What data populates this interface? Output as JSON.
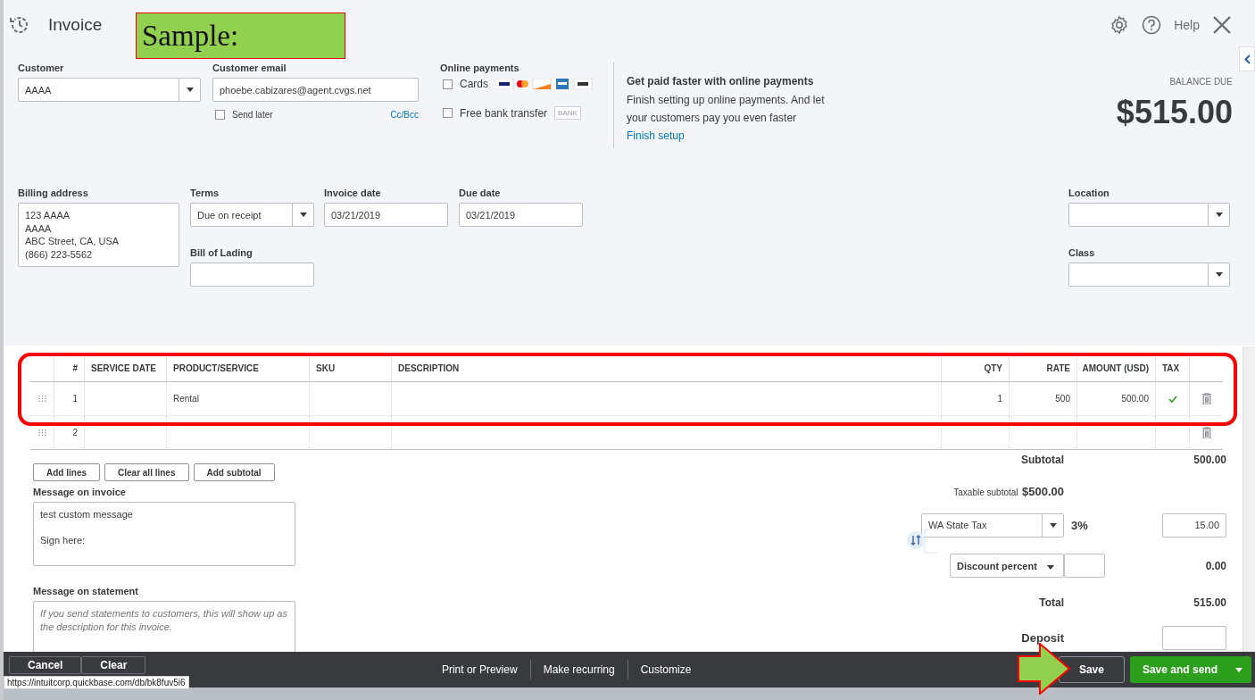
{
  "header": {
    "title": "Invoice",
    "help": "Help"
  },
  "annotation": {
    "label": "Sample:"
  },
  "customer": {
    "label": "Customer",
    "value": "AAAA"
  },
  "email": {
    "label": "Customer email",
    "value": "phoebe.cabizares@agent.cvgs.net",
    "send_later_label": "Send later",
    "send_later_checked": false,
    "cc_link": "Cc/Bcc"
  },
  "online_payments": {
    "label": "Online payments",
    "options": [
      {
        "kind": "cards",
        "label": "Cards",
        "checked": false
      },
      {
        "kind": "bank",
        "label": "Free bank transfer",
        "checked": false,
        "badge": "BANK"
      }
    ]
  },
  "promo": {
    "title": "Get paid faster with online payments",
    "body": "Finish setting up online payments. And let your customers pay you even faster",
    "link": "Finish setup"
  },
  "balance": {
    "label": "BALANCE DUE",
    "amount": "$515.00"
  },
  "billing_address": {
    "label": "Billing address",
    "value": "123 AAAA\nAAAA\nABC Street, CA, USA\n(866) 223-5562"
  },
  "terms": {
    "label": "Terms",
    "value": "Due on receipt"
  },
  "invoice_date": {
    "label": "Invoice date",
    "value": "03/21/2019"
  },
  "due_date": {
    "label": "Due date",
    "value": "03/21/2019"
  },
  "bill_of_lading": {
    "label": "Bill of Lading"
  },
  "location": {
    "label": "Location"
  },
  "class": {
    "label": "Class"
  },
  "table": {
    "columns": [
      "#",
      "SERVICE DATE",
      "PRODUCT/SERVICE",
      "SKU",
      "DESCRIPTION",
      "QTY",
      "RATE",
      "AMOUNT (USD)",
      "TAX"
    ],
    "rows": [
      {
        "number": "1",
        "product": "Rental",
        "qty": "1",
        "rate": "500",
        "amount": "500.00",
        "taxable": true
      },
      {
        "number": "2",
        "taxable": false
      }
    ]
  },
  "table_buttons": [
    "Add lines",
    "Clear all lines",
    "Add subtotal"
  ],
  "message_invoice": {
    "label": "Message on invoice",
    "value": "test custom message\n\nSign here:"
  },
  "message_statement": {
    "label": "Message on statement",
    "placeholder": "If you send statements to customers, this will show up as the description for this invoice."
  },
  "totals": {
    "subtotal_label": "Subtotal",
    "subtotal": "500.00",
    "taxable_label": "Taxable subtotal",
    "taxable_value": "$500.00",
    "tax_select": "WA State Tax",
    "tax_rate": "3%",
    "tax_amount": "15.00",
    "discount_select": "Discount percent",
    "discount_value": "0.00",
    "total_label": "Total",
    "total": "515.00",
    "deposit_label": "Deposit"
  },
  "footer": {
    "left": [
      "Cancel",
      "Clear"
    ],
    "center": [
      "Print or Preview",
      "Make recurring",
      "Customize"
    ],
    "save": "Save",
    "save_and_send": "Save and send"
  },
  "status_url": "https://intuitcorp.quickbase.com/db/bk8fuv5i6"
}
